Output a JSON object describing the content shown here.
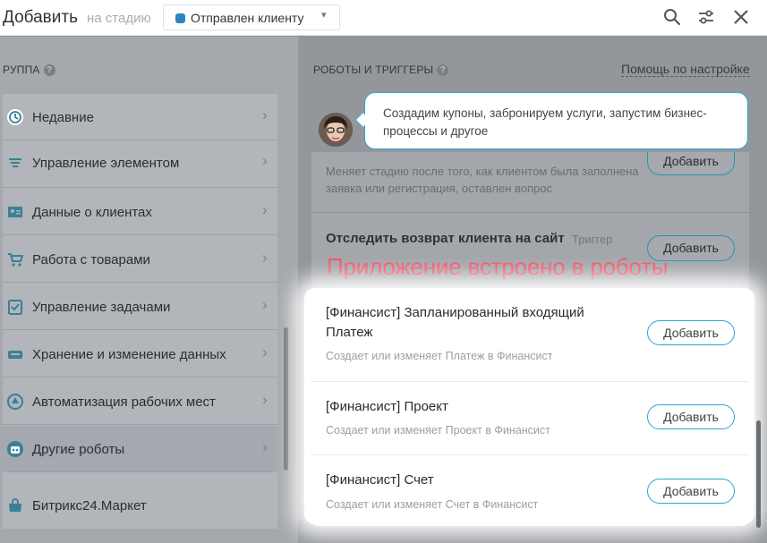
{
  "header": {
    "title": "Добавить",
    "subtitle": "на стадию",
    "stage": "Отправлен клиенту",
    "stage_color": "#2e86c1",
    "icons": [
      "search-icon",
      "filter-icon",
      "close-icon"
    ]
  },
  "left": {
    "group_label": "РУППА",
    "items": [
      {
        "label": "Недавние",
        "icon": "history-icon"
      },
      {
        "label": "Управление элементом",
        "icon": "filter-icon"
      },
      {
        "label": "Данные о клиентах",
        "icon": "contact-card-icon"
      },
      {
        "label": "Работа с товарами",
        "icon": "cart-icon"
      },
      {
        "label": "Управление задачами",
        "icon": "task-icon"
      },
      {
        "label": "Хранение и изменение данных",
        "icon": "storage-icon"
      },
      {
        "label": "Автоматизация рабочих мест",
        "icon": "workplace-icon"
      },
      {
        "label": "Другие роботы",
        "icon": "robot-icon",
        "active": true
      },
      {
        "label": "Битрикс24.Маркет",
        "icon": "market-icon"
      }
    ]
  },
  "right": {
    "section_label": "РОБОТЫ И ТРИГГЕРЫ",
    "help_link": "Помощь по настройке",
    "bubble_text": "Создадим купоны, забронируем услуги, запустим бизнес-процессы и другое",
    "dim_card_1": {
      "desc": "Меняет стадию после того, как клиентом была заполнена заявка или регистрация, оставлен вопрос",
      "button": "Добавить"
    },
    "dim_card_2": {
      "title": "Отследить возврат клиента на сайт",
      "badge": "Триггер",
      "button": "Добавить"
    },
    "overlay": "Приложение встроено в роботы",
    "cards": [
      {
        "title": "[Финансист] Запланированный входящий Платеж",
        "desc": "Создает или изменяет Платеж в Финансист",
        "button": "Добавить"
      },
      {
        "title": "[Финансист] Проект",
        "desc": "Создает или изменяет Проект в Финансист",
        "button": "Добавить"
      },
      {
        "title": "[Финансист] Счет",
        "desc": "Создает или изменяет Счет в Финансист",
        "button": "Добавить"
      }
    ],
    "accent_color": "#2fa4d3",
    "overlay_color": "#f5576c"
  }
}
